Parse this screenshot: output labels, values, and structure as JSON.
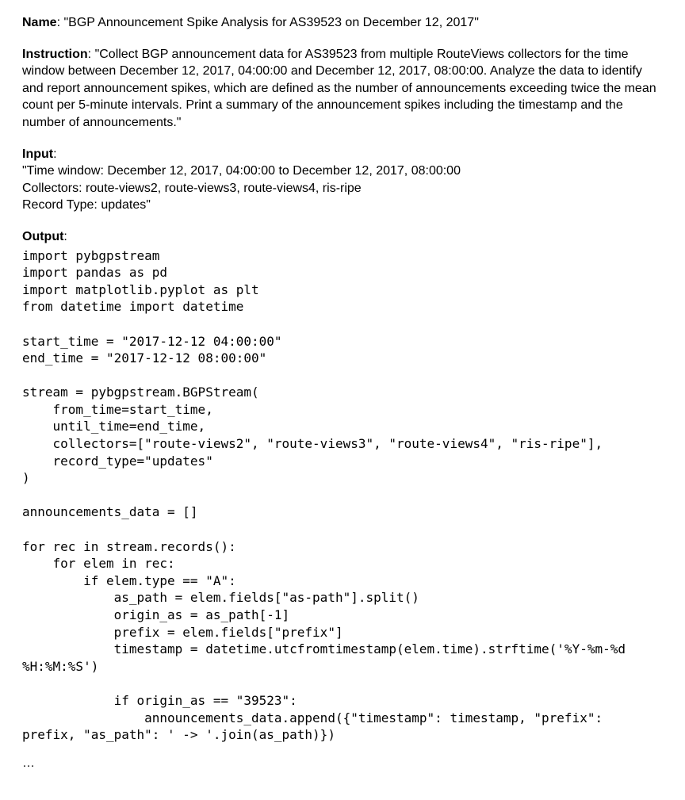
{
  "name": {
    "label": "Name",
    "value": "\"BGP Announcement Spike Analysis for AS39523 on December 12, 2017\""
  },
  "instruction": {
    "label": "Instruction",
    "value": "\"Collect BGP announcement data for AS39523 from multiple RouteViews collectors for the time window between December 12, 2017, 04:00:00 and December 12, 2017, 08:00:00. Analyze the data to identify and report announcement spikes, which are defined as the number of announcements exceeding twice the mean count per 5-minute intervals. Print a summary of the announcement spikes including the timestamp and the number of announcements.\""
  },
  "input": {
    "label": "Input",
    "lines": [
      "\"Time window: December 12, 2017, 04:00:00 to December 12, 2017, 08:00:00",
      "Collectors: route-views2, route-views3, route-views4, ris-ripe",
      "Record Type: updates\""
    ]
  },
  "output": {
    "label": "Output",
    "code": "import pybgpstream\nimport pandas as pd\nimport matplotlib.pyplot as plt\nfrom datetime import datetime\n\nstart_time = \"2017-12-12 04:00:00\"\nend_time = \"2017-12-12 08:00:00\"\n\nstream = pybgpstream.BGPStream(\n    from_time=start_time,\n    until_time=end_time,\n    collectors=[\"route-views2\", \"route-views3\", \"route-views4\", \"ris-ripe\"],\n    record_type=\"updates\"\n)\n\nannouncements_data = []\n\nfor rec in stream.records():\n    for elem in rec:\n        if elem.type == \"A\":\n            as_path = elem.fields[\"as-path\"].split()\n            origin_as = as_path[-1]\n            prefix = elem.fields[\"prefix\"]\n            timestamp = datetime.utcfromtimestamp(elem.time).strftime('%Y-%m-%d %H:%M:%S')\n\n            if origin_as == \"39523\":\n                announcements_data.append({\"timestamp\": timestamp, \"prefix\": prefix, \"as_path\": ' -> '.join(as_path)})"
  },
  "ellipsis": "…"
}
